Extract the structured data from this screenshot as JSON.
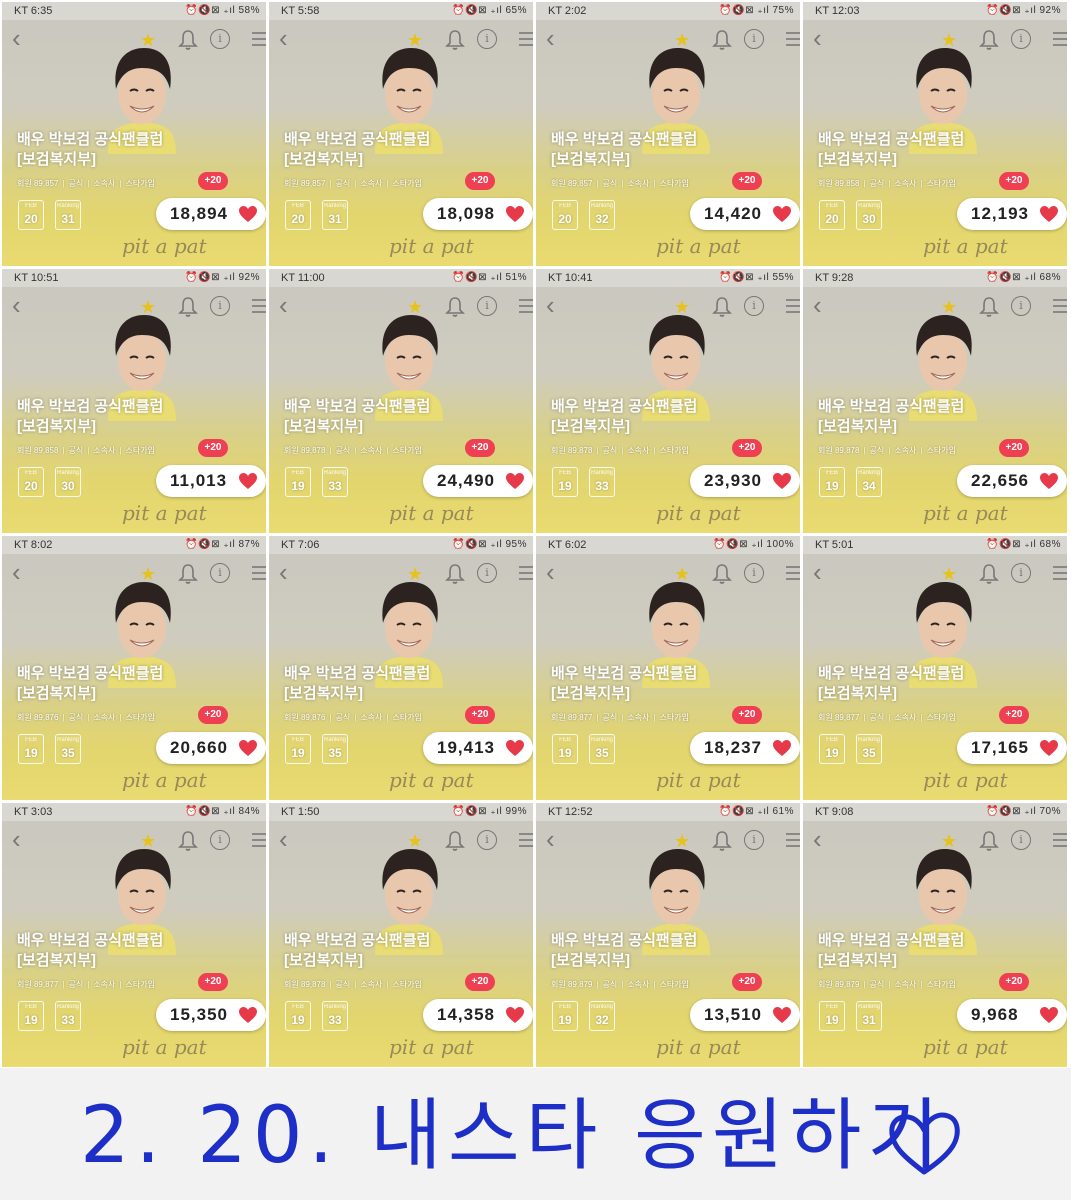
{
  "common": {
    "star_icon": "star-icon",
    "bell_icon": "bell-icon",
    "info_icon": "info-icon",
    "menu_icon": "menu-icon",
    "back_icon": "back-arrow-icon",
    "title_line1": "배우 박보검 공식팬클럽",
    "title_line2": "[보검복지부]",
    "meta_official": "공식",
    "meta_agency": "소속사",
    "meta_join": "스타가입",
    "feb_label": "FEB",
    "ranking_label": "Ranking",
    "bonus": "+20",
    "ad_text": "pit a pat",
    "accent_color": "#ef3f52",
    "star_color": "#e7c21b"
  },
  "screenshots": [
    {
      "time": "KT 6:35",
      "status": "⏰🔇⊠ ₊ıl 58%",
      "members": "회원 89,857",
      "feb": "20",
      "ranking": "31",
      "votes": "18,894"
    },
    {
      "time": "KT 5:58",
      "status": "⏰🔇⊠ ₊ıl 65%",
      "members": "회원 89,857",
      "feb": "20",
      "ranking": "31",
      "votes": "18,098"
    },
    {
      "time": "KT 2:02",
      "status": "⏰🔇⊠ ₊ıl 75%",
      "members": "회원 89,857",
      "feb": "20",
      "ranking": "32",
      "votes": "14,420"
    },
    {
      "time": "KT 12:03",
      "status": "⏰🔇⊠ ₊ıl 92%",
      "members": "회원 89,858",
      "feb": "20",
      "ranking": "30",
      "votes": "12,193"
    },
    {
      "time": "KT 10:51",
      "status": "⏰🔇⊠ ₊ıl 92%",
      "members": "회원 89,858",
      "feb": "20",
      "ranking": "30",
      "votes": "11,013"
    },
    {
      "time": "KT 11:00",
      "status": "⏰🔇⊠ ₊ıl 51%",
      "members": "회원 89,878",
      "feb": "19",
      "ranking": "33",
      "votes": "24,490"
    },
    {
      "time": "KT 10:41",
      "status": "⏰🔇⊠ ₊ıl 55%",
      "members": "회원 89,878",
      "feb": "19",
      "ranking": "33",
      "votes": "23,930"
    },
    {
      "time": "KT 9:28",
      "status": "⏰🔇⊠ ₊ıl 68%",
      "members": "회원 89,878",
      "feb": "19",
      "ranking": "34",
      "votes": "22,656"
    },
    {
      "time": "KT 8:02",
      "status": "⏰🔇⊠ ₊ıl 87%",
      "members": "회원 89,876",
      "feb": "19",
      "ranking": "35",
      "votes": "20,660"
    },
    {
      "time": "KT 7:06",
      "status": "⏰🔇⊠ ₊ıl 95%",
      "members": "회원 89,876",
      "feb": "19",
      "ranking": "35",
      "votes": "19,413"
    },
    {
      "time": "KT 6:02",
      "status": "⏰🔇⊠ ₊ıl 100%",
      "members": "회원 89,877",
      "feb": "19",
      "ranking": "35",
      "votes": "18,237"
    },
    {
      "time": "KT 5:01",
      "status": "⏰🔇⊠ ₊ıl 68%",
      "members": "회원 89,877",
      "feb": "19",
      "ranking": "35",
      "votes": "17,165"
    },
    {
      "time": "KT 3:03",
      "status": "⏰🔇⊠ ₊ıl 84%",
      "members": "회원 89,877",
      "feb": "19",
      "ranking": "33",
      "votes": "15,350"
    },
    {
      "time": "KT 1:50",
      "status": "⏰🔇⊠ ₊ıl 99%",
      "members": "회원 89,878",
      "feb": "19",
      "ranking": "33",
      "votes": "14,358"
    },
    {
      "time": "KT 12:52",
      "status": "⏰🔇⊠ ₊ıl 61%",
      "members": "회원 89,879",
      "feb": "19",
      "ranking": "32",
      "votes": "13,510"
    },
    {
      "time": "KT 9:08",
      "status": "⏰🔇⊠ ₊ıl 70%",
      "members": "회원 89,879",
      "feb": "19",
      "ranking": "31",
      "votes": "9,968"
    }
  ],
  "caption": {
    "text": "2. 20. 내스타 응원하기",
    "heart_icon": "heart-icon",
    "color": "#1d2fc7"
  }
}
